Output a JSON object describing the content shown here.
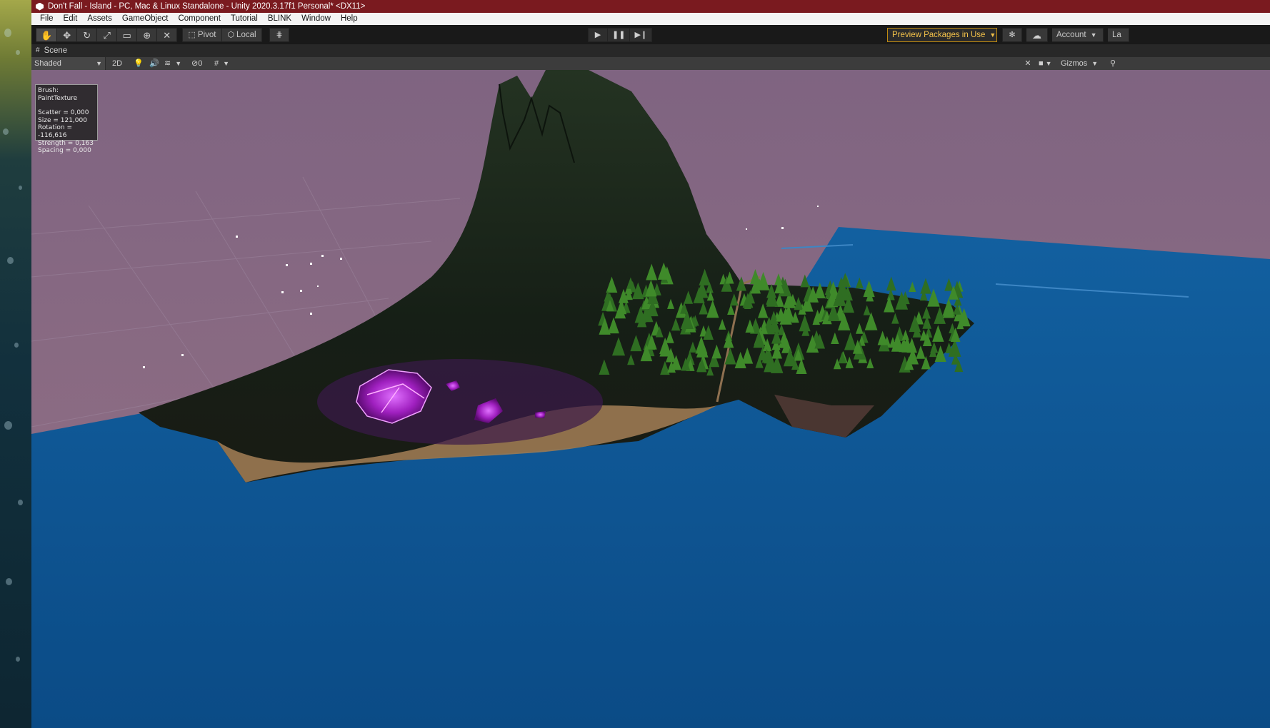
{
  "window": {
    "title": "Don't Fall - Island - PC, Mac & Linux Standalone - Unity 2020.3.17f1 Personal* <DX11>"
  },
  "menubar": {
    "items": [
      "File",
      "Edit",
      "Assets",
      "GameObject",
      "Component",
      "Tutorial",
      "BLINK",
      "Window",
      "Help"
    ]
  },
  "toolbar": {
    "pivot_label": "Pivot",
    "local_label": "Local",
    "preview_packages_label": "Preview Packages in Use",
    "account_label": "Account",
    "layers_label": "La",
    "tools": [
      "hand-icon",
      "move-icon",
      "rotate-icon",
      "scale-icon",
      "rect-icon",
      "transform-icon",
      "custom-tool-icon"
    ]
  },
  "scene_tab": {
    "label": "Scene"
  },
  "scene_toolbar": {
    "shading_mode": "Shaded",
    "mode_2d_label": "2D",
    "hidden_count": "0",
    "gizmos_label": "Gizmos"
  },
  "brush_info": {
    "title": "Brush: PaintTexture",
    "scatter": "Scatter = 0,000",
    "size": "Size = 121,000",
    "rotation": "Rotation = -116,616",
    "strength": "Strength = 0,163",
    "spacing": "Spacing = 0,000"
  },
  "colors": {
    "title_bar": "#7a1a1f",
    "preview_accent": "#f2c14a",
    "sky_top": "#7f6481",
    "water": "#0f4f8a"
  }
}
